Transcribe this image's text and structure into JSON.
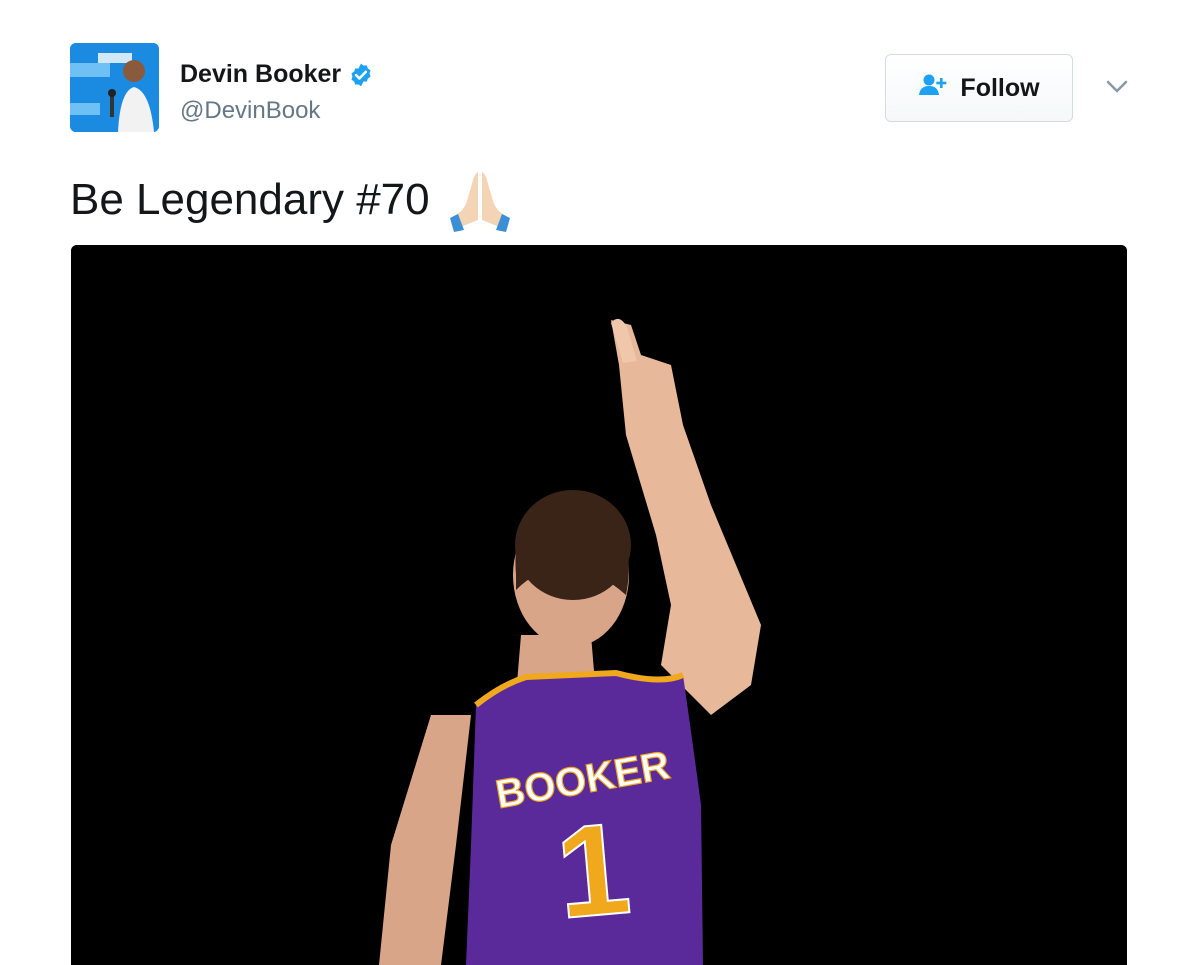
{
  "user": {
    "display_name": "Devin Booker",
    "handle": "@DevinBook",
    "verified_icon": "verified-badge-icon",
    "avatar_icon": "profile-photo"
  },
  "follow_button": {
    "label": "Follow",
    "icon": "add-user-icon"
  },
  "menu_caret_icon": "chevron-down-icon",
  "tweet": {
    "text": "Be Legendary #70",
    "emoji": "folded-hands-icon"
  },
  "media": {
    "jersey_name": "BOOKER",
    "jersey_number": "1"
  },
  "colors": {
    "twitter_blue": "#1da1f2",
    "text_primary": "#14171a",
    "text_secondary": "#657786",
    "jersey_purple": "#5b2a9a",
    "jersey_gold": "#f0a81c"
  }
}
